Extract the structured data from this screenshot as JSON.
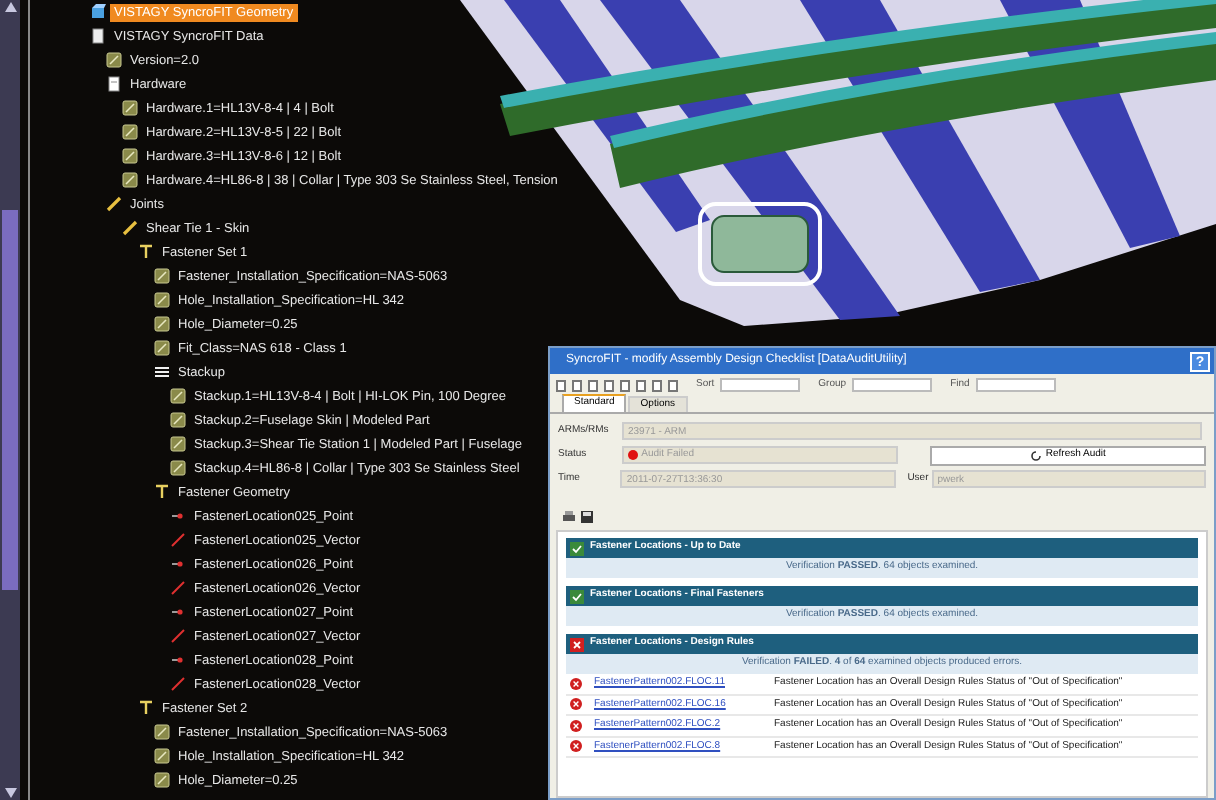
{
  "tree": [
    {
      "label": "VISTAGY SyncroFIT Geometry",
      "kind": "geometry",
      "selected": true
    },
    {
      "label": "VISTAGY SyncroFIT Data",
      "kind": "data",
      "selected": false,
      "children": [
        {
          "label": "Version=2.0",
          "kind": "parameter",
          "selected": false
        },
        {
          "label": "Hardware",
          "kind": "folder",
          "selected": false,
          "children": [
            {
              "label": "Hardware.1=HL13V-8-4 | 4 | Bolt",
              "kind": "parameter",
              "selected": false
            },
            {
              "label": "Hardware.2=HL13V-8-5 | 22 | Bolt",
              "kind": "parameter",
              "selected": false
            },
            {
              "label": "Hardware.3=HL13V-8-6 | 12 | Bolt",
              "kind": "parameter",
              "selected": false
            },
            {
              "label": "Hardware.4=HL86-8 | 38 | Collar | Type 303 Se Stainless Steel, Tension",
              "kind": "parameter",
              "selected": false
            }
          ]
        },
        {
          "label": "Joints",
          "kind": "joint",
          "selected": false,
          "children": [
            {
              "label": "Shear Tie 1 - Skin",
              "kind": "joint",
              "selected": false,
              "children": [
                {
                  "label": "Fastener Set 1",
                  "kind": "set",
                  "selected": false,
                  "children": [
                    {
                      "label": "Fastener_Installation_Specification=NAS-5063",
                      "kind": "parameter",
                      "selected": false
                    },
                    {
                      "label": "Hole_Installation_Specification=HL 342",
                      "kind": "parameter",
                      "selected": false
                    },
                    {
                      "label": "Hole_Diameter=0.25",
                      "kind": "parameter",
                      "selected": false
                    },
                    {
                      "label": "Fit_Class=NAS 618 - Class 1",
                      "kind": "parameter",
                      "selected": false
                    },
                    {
                      "label": "Stackup",
                      "kind": "stackup",
                      "selected": false,
                      "children": [
                        {
                          "label": "Stackup.1=HL13V-8-4 | Bolt | HI-LOK Pin, 100 Degree",
                          "kind": "parameter",
                          "selected": false
                        },
                        {
                          "label": "Stackup.2=Fuselage Skin | Modeled Part",
                          "kind": "parameter",
                          "selected": false
                        },
                        {
                          "label": "Stackup.3=Shear Tie Station 1 | Modeled Part | Fuselage",
                          "kind": "parameter",
                          "selected": false
                        },
                        {
                          "label": "Stackup.4=HL86-8 | Collar | Type 303 Se Stainless Steel",
                          "kind": "parameter",
                          "selected": false
                        }
                      ]
                    },
                    {
                      "label": "Fastener Geometry",
                      "kind": "set",
                      "selected": false,
                      "children": [
                        {
                          "label": "FastenerLocation025_Point",
                          "kind": "point",
                          "selected": false
                        },
                        {
                          "label": "FastenerLocation025_Vector",
                          "kind": "vector",
                          "selected": false
                        },
                        {
                          "label": "FastenerLocation026_Point",
                          "kind": "point",
                          "selected": false
                        },
                        {
                          "label": "FastenerLocation026_Vector",
                          "kind": "vector",
                          "selected": false
                        },
                        {
                          "label": "FastenerLocation027_Point",
                          "kind": "point",
                          "selected": false
                        },
                        {
                          "label": "FastenerLocation027_Vector",
                          "kind": "vector",
                          "selected": false
                        },
                        {
                          "label": "FastenerLocation028_Point",
                          "kind": "point",
                          "selected": false
                        },
                        {
                          "label": "FastenerLocation028_Vector",
                          "kind": "vector",
                          "selected": false
                        }
                      ]
                    }
                  ]
                },
                {
                  "label": "Fastener Set 2",
                  "kind": "set",
                  "selected": false,
                  "children": [
                    {
                      "label": "Fastener_Installation_Specification=NAS-5063",
                      "kind": "parameter",
                      "selected": false
                    },
                    {
                      "label": "Hole_Installation_Specification=HL 342",
                      "kind": "parameter",
                      "selected": false
                    },
                    {
                      "label": "Hole_Diameter=0.25",
                      "kind": "parameter",
                      "selected": false
                    }
                  ]
                }
              ]
            }
          ]
        }
      ]
    }
  ],
  "dialog": {
    "title": "SyncroFIT - modify Assembly Design Checklist [DataAuditUtility]",
    "help": "?",
    "toolbar": {
      "sort": "Sort",
      "group": "Group",
      "find": "Find"
    },
    "tabs": [
      {
        "label": "Standard",
        "selected": true
      },
      {
        "label": "Options",
        "selected": false
      }
    ],
    "armsrms": {
      "label": "ARMs/RMs",
      "value": "23971 - ARM"
    },
    "status": {
      "label": "Status",
      "value": "Audit Failed",
      "color": "#e01010"
    },
    "refresh_button": "Refresh Audit",
    "time": {
      "label": "Time",
      "value": "2011-07-27T13:36:30"
    },
    "user": {
      "label": "User",
      "value": "pwerk"
    },
    "sections": [
      {
        "title": "Fastener Locations - Up to Date",
        "kind": "passed",
        "message": "Verification **PASSED**. 64 objects examined."
      },
      {
        "title": "Fastener Locations - Final Fasteners",
        "kind": "passed",
        "message": "Verification **PASSED**. 64 objects examined."
      },
      {
        "title": "Fastener Locations - Design Rules",
        "kind": "failed",
        "message": "Verification **FAILED**. **4** of **64** examined objects produced errors.",
        "errors": [
          {
            "link": "FastenerPattern002.FLOC.11",
            "message": "Fastener Location has an Overall Design Rules Status of \"Out of Specification\""
          },
          {
            "link": "FastenerPattern002.FLOC.16",
            "message": "Fastener Location has an Overall Design Rules Status of \"Out of Specification\""
          },
          {
            "link": "FastenerPattern002.FLOC.2",
            "message": "Fastener Location has an Overall Design Rules Status of \"Out of Specification\""
          },
          {
            "link": "FastenerPattern002.FLOC.8",
            "message": "Fastener Location has an Overall Design Rules Status of \"Out of Specification\""
          }
        ]
      }
    ]
  }
}
